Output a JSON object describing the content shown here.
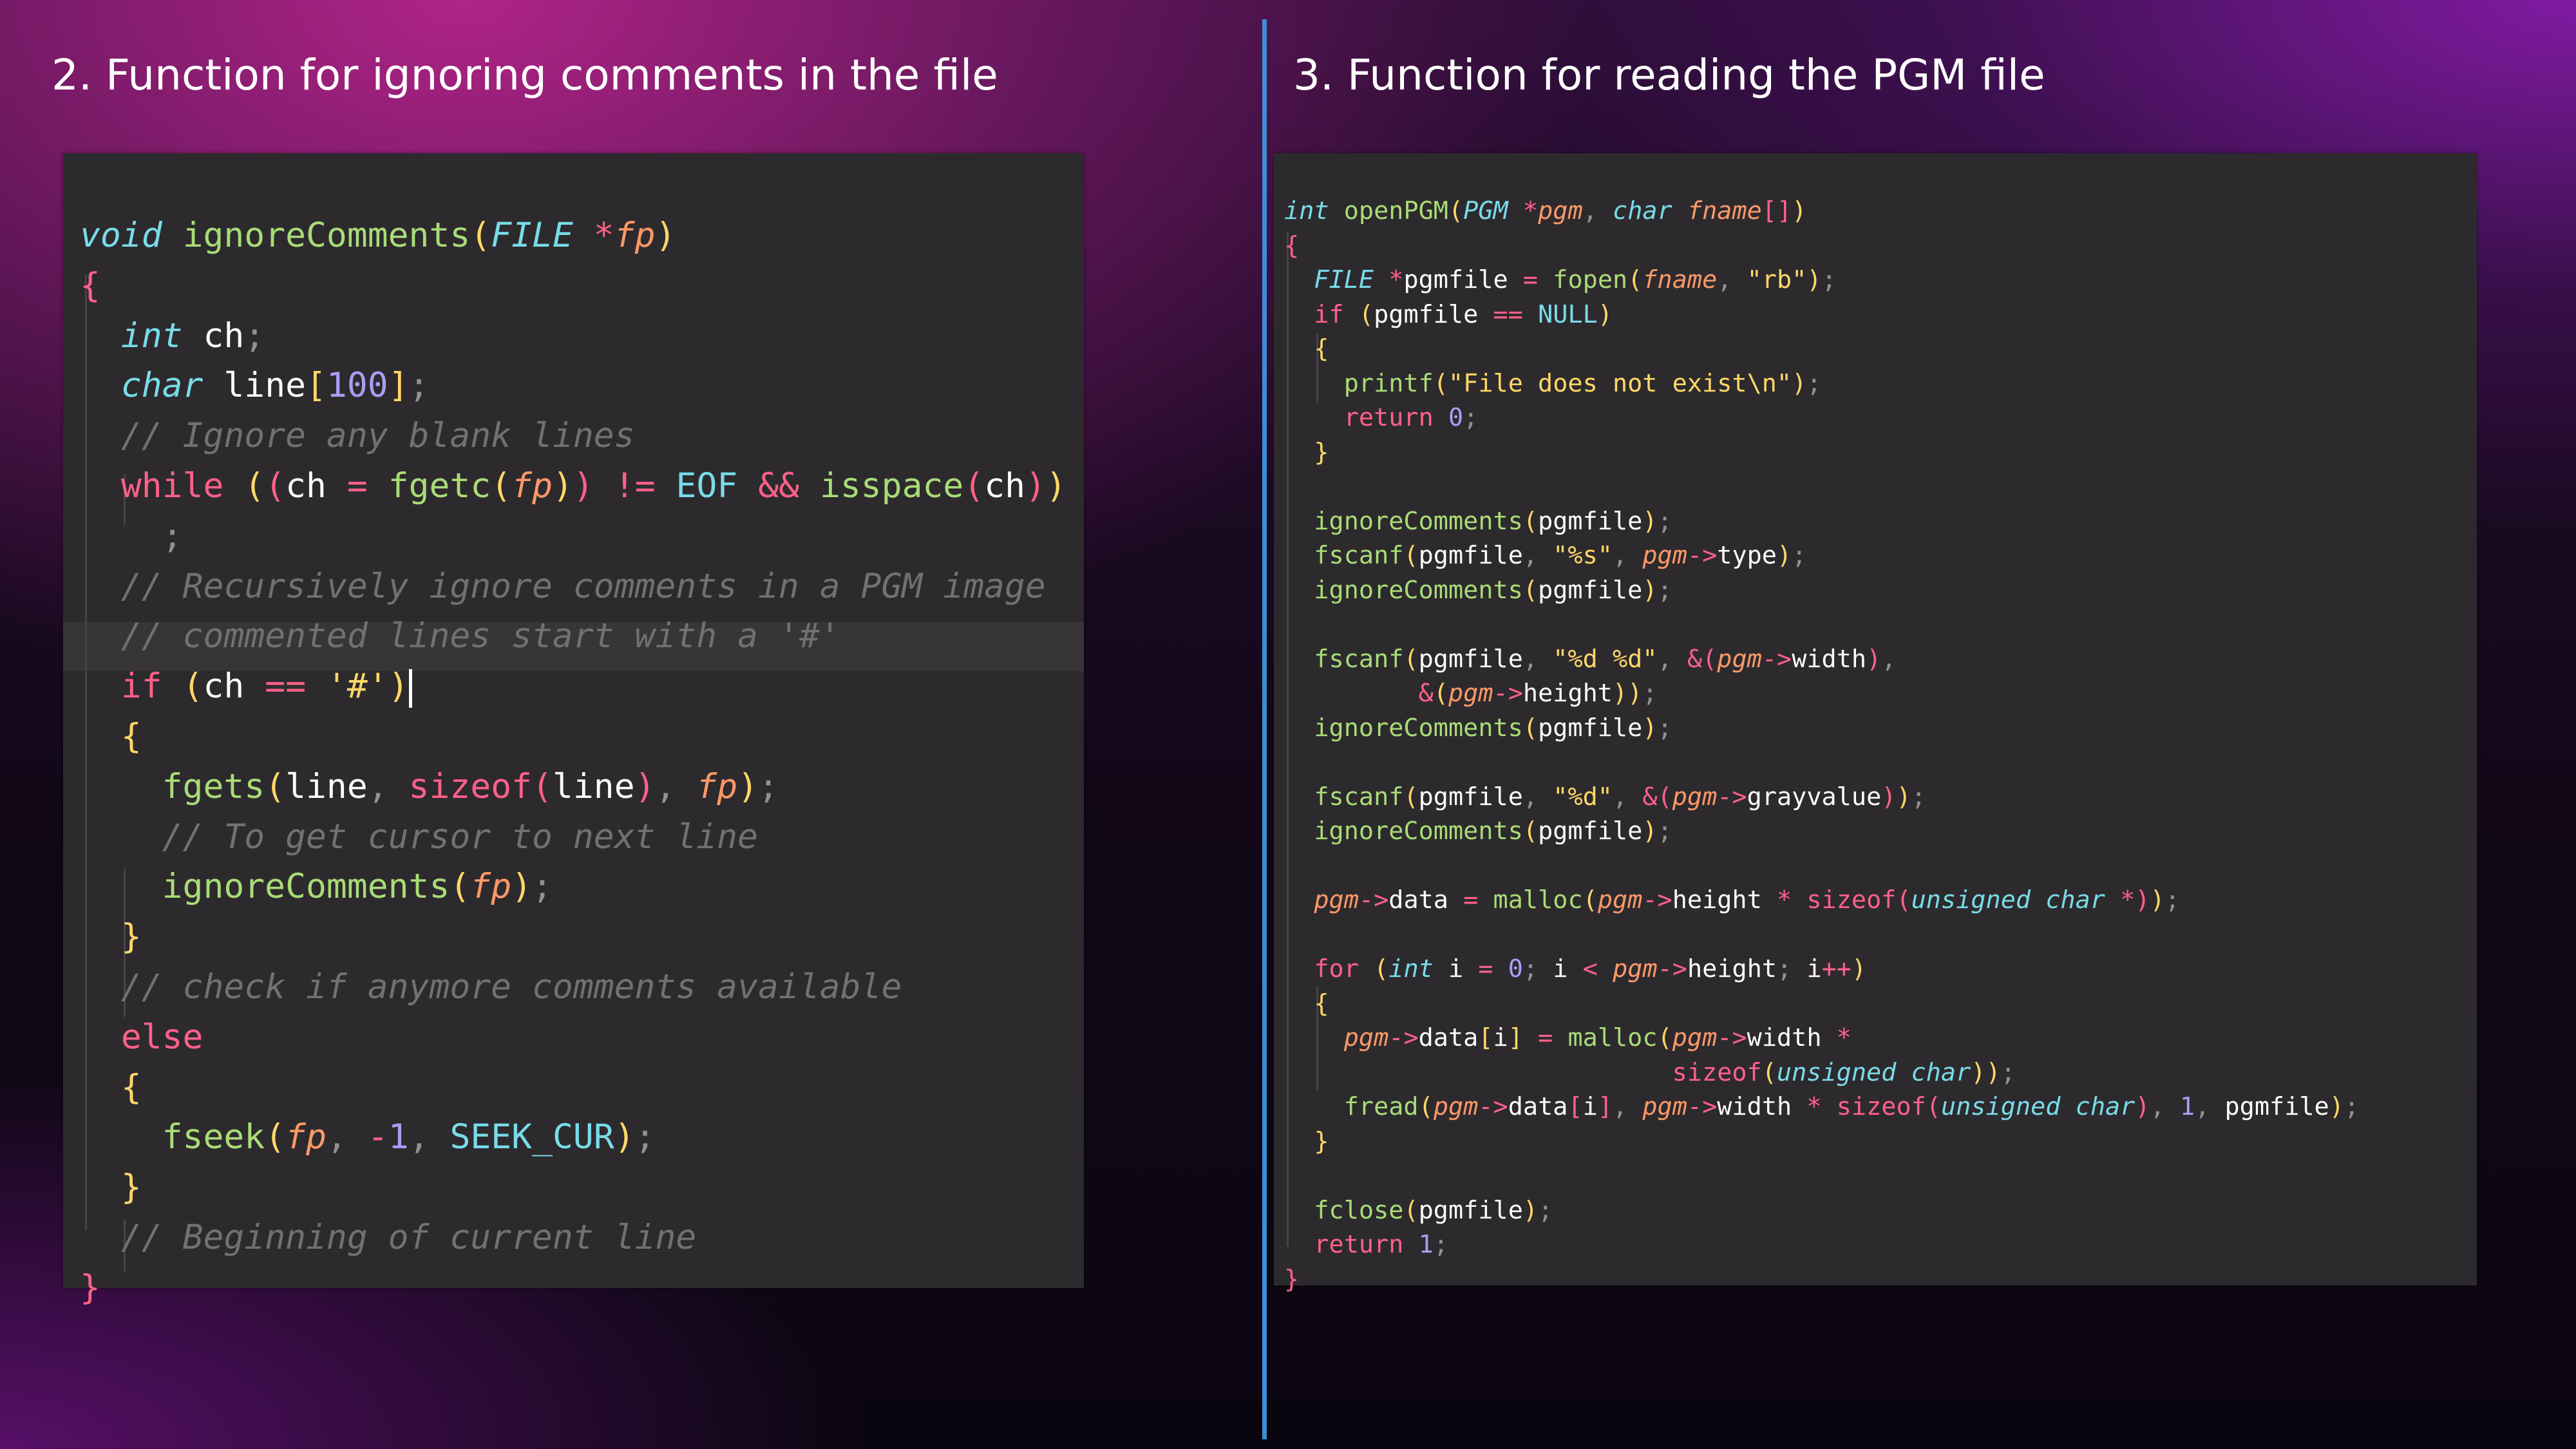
{
  "slide": {
    "left_title": "2.  Function for ignoring comments in the file",
    "right_title": "3.  Function for reading the PGM file"
  },
  "left_code": {
    "function_name": "ignoreComments",
    "lines": [
      "void ignoreComments(FILE *fp)",
      "{",
      "  int ch;",
      "  char line[100];",
      "  // Ignore any blank lines",
      "  while ((ch = fgetc(fp)) != EOF && isspace(ch))",
      "    ;",
      "  // Recursively ignore comments in a PGM image",
      "  // commented lines start with a '#'",
      "  if (ch == '#')",
      "  {",
      "    fgets(line, sizeof(line), fp);",
      "    // To get cursor to next line",
      "    ignoreComments(fp);",
      "  }",
      "  // check if anymore comments available",
      "  else",
      "  {",
      "    fseek(fp, -1, SEEK_CUR);",
      "  }",
      "  // Beginning of current line",
      "}"
    ],
    "highlighted_line": 10
  },
  "right_code": {
    "function_name": "openPGM",
    "lines": [
      "int openPGM(PGM *pgm, char fname[])",
      "{",
      "  FILE *pgmfile = fopen(fname, \"rb\");",
      "  if (pgmfile == NULL)",
      "  {",
      "    printf(\"File does not exist\\n\");",
      "    return 0;",
      "  }",
      "",
      "  ignoreComments(pgmfile);",
      "  fscanf(pgmfile, \"%s\", pgm->type);",
      "  ignoreComments(pgmfile);",
      "",
      "  fscanf(pgmfile, \"%d %d\", &(pgm->width),",
      "         &(pgm->height));",
      "  ignoreComments(pgmfile);",
      "",
      "  fscanf(pgmfile, \"%d\", &(pgm->grayvalue));",
      "  ignoreComments(pgmfile);",
      "",
      "  pgm->data = malloc(pgm->height * sizeof(unsigned char *));",
      "",
      "  for (int i = 0; i < pgm->height; i++)",
      "  {",
      "    pgm->data[i] = malloc(pgm->width *",
      "                          sizeof(unsigned char));",
      "    fread(pgm->data[i], pgm->width * sizeof(unsigned char), 1, pgmfile);",
      "  }",
      "",
      "  fclose(pgmfile);",
      "  return 1;",
      "}"
    ]
  },
  "colors": {
    "keyword": "#ff6188",
    "type": "#78dce8",
    "function": "#a9dc76",
    "parameter": "#fc9867",
    "string": "#ffd866",
    "number": "#ab9df2",
    "comment": "#727072",
    "panel_background": "#2d2a2e",
    "divider": "#3b8fd6"
  }
}
